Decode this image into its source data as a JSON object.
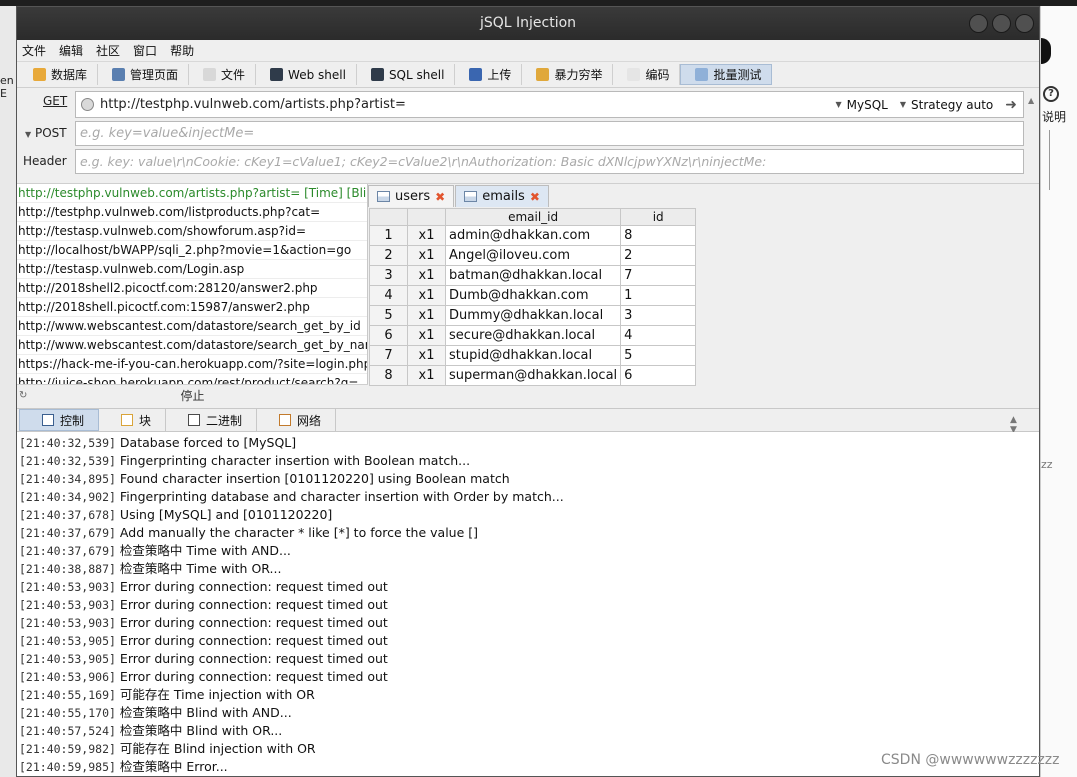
{
  "background": {
    "left_fragment": "en E",
    "help_label": "说明",
    "side_text": "zz"
  },
  "window": {
    "title": "jSQL Injection"
  },
  "menu": [
    "文件",
    "编辑",
    "社区",
    "窗口",
    "帮助"
  ],
  "toolbar": [
    {
      "label": "数据库",
      "icon": "database-icon",
      "color": "#e8a93a"
    },
    {
      "label": "管理页面",
      "icon": "wrench-icon",
      "color": "#5a7fb0"
    },
    {
      "label": "文件",
      "icon": "file-icon",
      "color": "#d8d8d8"
    },
    {
      "label": "Web shell",
      "icon": "terminal-icon",
      "color": "#2f3b4a"
    },
    {
      "label": "SQL shell",
      "icon": "terminal-icon",
      "color": "#2f3b4a"
    },
    {
      "label": "上传",
      "icon": "floppy-icon",
      "color": "#3a66b0"
    },
    {
      "label": "暴力穷举",
      "icon": "lock-icon",
      "color": "#e0a83b"
    },
    {
      "label": "编码",
      "icon": "encode-icon",
      "color": "#e5e5e5"
    },
    {
      "label": "批量测试",
      "icon": "batch-icon",
      "color": "#8fb0d8"
    }
  ],
  "request": {
    "get_label": "GET",
    "url": "http://testphp.vulnweb.com/artists.php?artist=",
    "db_select": "MySQL",
    "strategy_select": "Strategy auto",
    "post_label": "POST",
    "post_placeholder": "e.g. key=value&injectMe=",
    "header_label": "Header",
    "header_placeholder": "e.g. key: value\\r\\nCookie: cKey1=cValue1; cKey2=cValue2\\r\\nAuthorization: Basic dXNlcjpwYXNz\\r\\ninjectMe:"
  },
  "url_list": [
    "http://testphp.vulnweb.com/artists.php?artist= [Time] [Blind]",
    "http://testphp.vulnweb.com/listproducts.php?cat=",
    "http://testasp.vulnweb.com/showforum.asp?id=",
    "http://localhost/bWAPP/sqli_2.php?movie=1&action=go",
    "http://testasp.vulnweb.com/Login.asp",
    "http://2018shell2.picoctf.com:28120/answer2.php",
    "http://2018shell.picoctf.com:15987/answer2.php",
    "http://www.webscantest.com/datastore/search_get_by_id",
    "http://www.webscantest.com/datastore/search_get_by_name",
    "https://hack-me-if-you-can.herokuapp.com/?site=login.php",
    "http://juice-shop.herokuapp.com/rest/product/search?q="
  ],
  "stop_label": "停止",
  "result_tabs": [
    {
      "label": "users"
    },
    {
      "label": "emails"
    }
  ],
  "table": {
    "columns": [
      "email_id",
      "id"
    ],
    "rows": [
      {
        "n": "1",
        "x": "x1",
        "email": "admin@dhakkan.com",
        "id": "8"
      },
      {
        "n": "2",
        "x": "x1",
        "email": "Angel@iloveu.com",
        "id": "2"
      },
      {
        "n": "3",
        "x": "x1",
        "email": "batman@dhakkan.local",
        "id": "7"
      },
      {
        "n": "4",
        "x": "x1",
        "email": "Dumb@dhakkan.com",
        "id": "1"
      },
      {
        "n": "5",
        "x": "x1",
        "email": "Dummy@dhakkan.local",
        "id": "3"
      },
      {
        "n": "6",
        "x": "x1",
        "email": "secure@dhakkan.local",
        "id": "4"
      },
      {
        "n": "7",
        "x": "x1",
        "email": "stupid@dhakkan.local",
        "id": "5"
      },
      {
        "n": "8",
        "x": "x1",
        "email": "superman@dhakkan.local",
        "id": "6"
      }
    ]
  },
  "console_tabs": [
    {
      "label": "控制",
      "icon": "console-icon"
    },
    {
      "label": "块",
      "icon": "chunk-icon"
    },
    {
      "label": "二进制",
      "icon": "binary-icon"
    },
    {
      "label": "网络",
      "icon": "network-icon"
    }
  ],
  "console_lines": [
    {
      "ts": "[21:40:32,539]",
      "msg": "Database forced to [MySQL]"
    },
    {
      "ts": "[21:40:32,539]",
      "msg": "Fingerprinting character insertion with Boolean match..."
    },
    {
      "ts": "[21:40:34,895]",
      "msg": "Found character insertion [0101120220] using Boolean match"
    },
    {
      "ts": "[21:40:34,902]",
      "msg": "Fingerprinting database and character insertion with Order by match..."
    },
    {
      "ts": "[21:40:37,678]",
      "msg": "Using [MySQL] and [0101120220]"
    },
    {
      "ts": "[21:40:37,679]",
      "msg": "Add manually the character * like [*] to force the value []"
    },
    {
      "ts": "[21:40:37,679]",
      "msg": "检查策略中 Time with AND..."
    },
    {
      "ts": "[21:40:38,887]",
      "msg": "检查策略中 Time with OR..."
    },
    {
      "ts": "[21:40:53,903]",
      "msg": "Error during connection: request timed out"
    },
    {
      "ts": "[21:40:53,903]",
      "msg": "Error during connection: request timed out"
    },
    {
      "ts": "[21:40:53,903]",
      "msg": "Error during connection: request timed out"
    },
    {
      "ts": "[21:40:53,905]",
      "msg": "Error during connection: request timed out"
    },
    {
      "ts": "[21:40:53,905]",
      "msg": "Error during connection: request timed out"
    },
    {
      "ts": "[21:40:53,906]",
      "msg": "Error during connection: request timed out"
    },
    {
      "ts": "[21:40:55,169]",
      "msg": "可能存在 Time injection with OR"
    },
    {
      "ts": "[21:40:55,170]",
      "msg": "检查策略中 Blind with AND..."
    },
    {
      "ts": "[21:40:57,524]",
      "msg": "检查策略中 Blind with OR..."
    },
    {
      "ts": "[21:40:59,982]",
      "msg": "可能存在 Blind injection with OR"
    },
    {
      "ts": "[21:40:59,985]",
      "msg": "检查策略中 Error..."
    }
  ],
  "watermark": "CSDN @wwwwwwzzzzzzz"
}
